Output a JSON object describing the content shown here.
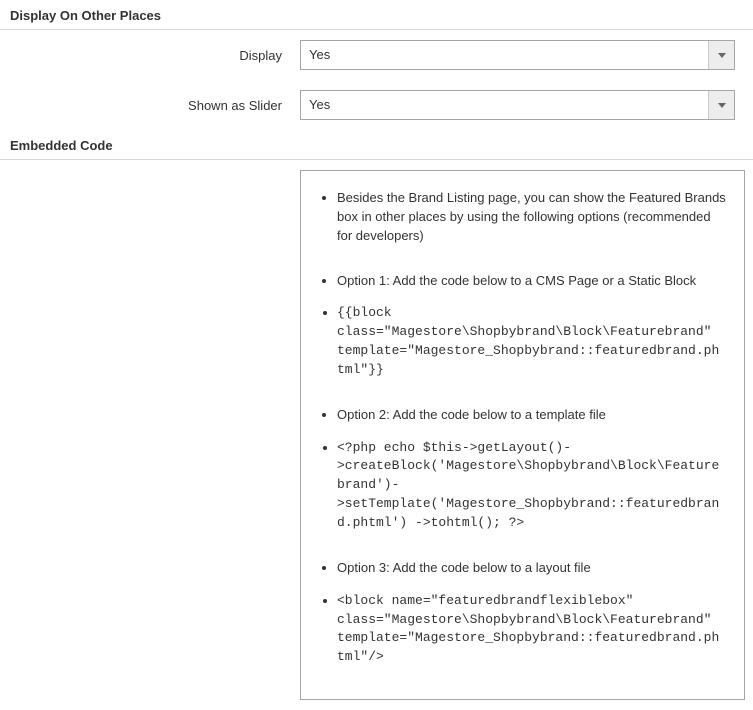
{
  "section1": {
    "heading": "Display On Other Places"
  },
  "form": {
    "display": {
      "label": "Display",
      "value": "Yes"
    },
    "slider": {
      "label": "Shown as Slider",
      "value": "Yes"
    }
  },
  "section2": {
    "heading": "Embedded Code"
  },
  "embedded": {
    "intro": "Besides the Brand Listing page, you can show the Featured Brands box in other places by using the following options (recommended for developers)",
    "opt1_label": "Option 1: Add the code below to a CMS Page or a Static Block",
    "opt1_code": "  {{block class=\"Magestore\\Shopbybrand\\Block\\Featurebrand\" template=\"Magestore_Shopbybrand::featuredbrand.phtml\"}}",
    "opt2_label": "Option 2: Add the code below to a template file",
    "opt2_code": "<?php echo  $this->getLayout()->createBlock('Magestore\\Shopbybrand\\Block\\Featurebrand')->setTemplate('Magestore_Shopbybrand::featuredbrand.phtml') ->tohtml(); ?>",
    "opt3_label": "Option 3: Add the code below to a layout file",
    "opt3_code": "  <block name=\"featuredbrandflexiblebox\" class=\"Magestore\\Shopbybrand\\Block\\Featurebrand\" template=\"Magestore_Shopbybrand::featuredbrand.phtml\"/>"
  }
}
